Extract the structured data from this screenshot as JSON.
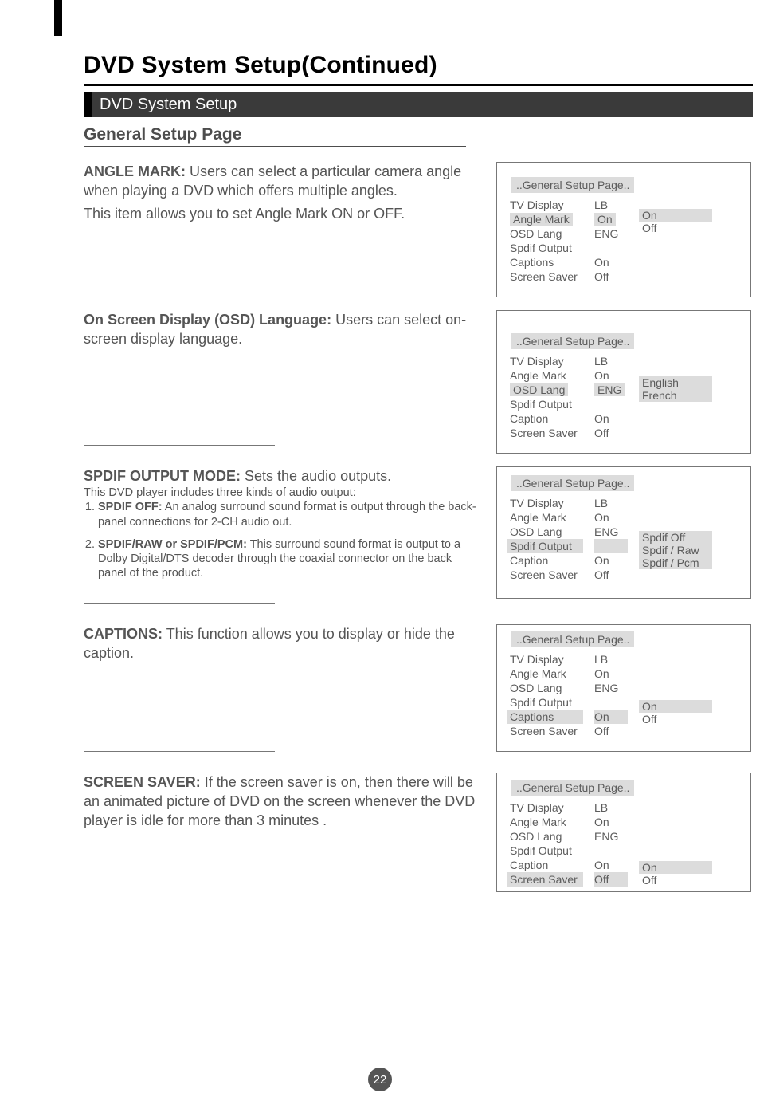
{
  "page": {
    "title": "DVD System Setup(Continued)",
    "section_bar": "DVD System Setup",
    "subheading": "General Setup Page",
    "number": "22"
  },
  "items": {
    "angle_mark": {
      "heading": "ANGLE MARK:",
      "body1": "Users can select a particular camera angle when playing  a DVD which offers multiple angles.",
      "body2": "This item allows you to set Angle Mark ON or OFF."
    },
    "osd_lang": {
      "heading": "On  Screen  Display (OSD) Language:",
      "body1": "Users can select on-screen display language."
    },
    "spdif": {
      "heading": "SPDIF OUTPUT MODE:",
      "body1": "Sets the audio outputs.",
      "intro": "This DVD player  includes three kinds  of audio output:",
      "li1_strong": "SPDIF OFF:",
      "li1_rest": "An analog surround sound format  is output through the back-panel connections for  2-CH audio out.",
      "li2_strong": "SPDIF/RAW or SPDIF/PCM:",
      "li2_rest": "This surround sound  format   is output to a Dolby  Digital/DTS decoder through the  coaxial connector on the  back panel of  the product."
    },
    "captions": {
      "heading": "CAPTIONS:",
      "body1": "This function allows you to display or hide the caption."
    },
    "screen_saver": {
      "heading": "SCREEN SAVER:",
      "body1": "If the screen saver is on, then there will be an animated picture of  DVD on the screen  whenever the DVD player is  idle for more than 3 minutes ."
    }
  },
  "menus": {
    "common_title": "..General Setup Page..",
    "labels": {
      "tv_display": "TV Display",
      "angle_mark": "Angle Mark",
      "osd_lang": "OSD Lang",
      "spdif_output": "Spdif Output",
      "captions": "Captions",
      "caption": "Caption",
      "screen_saver": "Screen Saver"
    },
    "values": {
      "lb": "LB",
      "on": "On",
      "off": "Off",
      "eng": "ENG"
    },
    "options": {
      "on": "On",
      "off": "Off",
      "english": "English",
      "french": "French",
      "spdif_off": "Spdif Off",
      "spdif_raw": "Spdif / Raw",
      "spdif_pcm": "Spdif / Pcm"
    }
  }
}
